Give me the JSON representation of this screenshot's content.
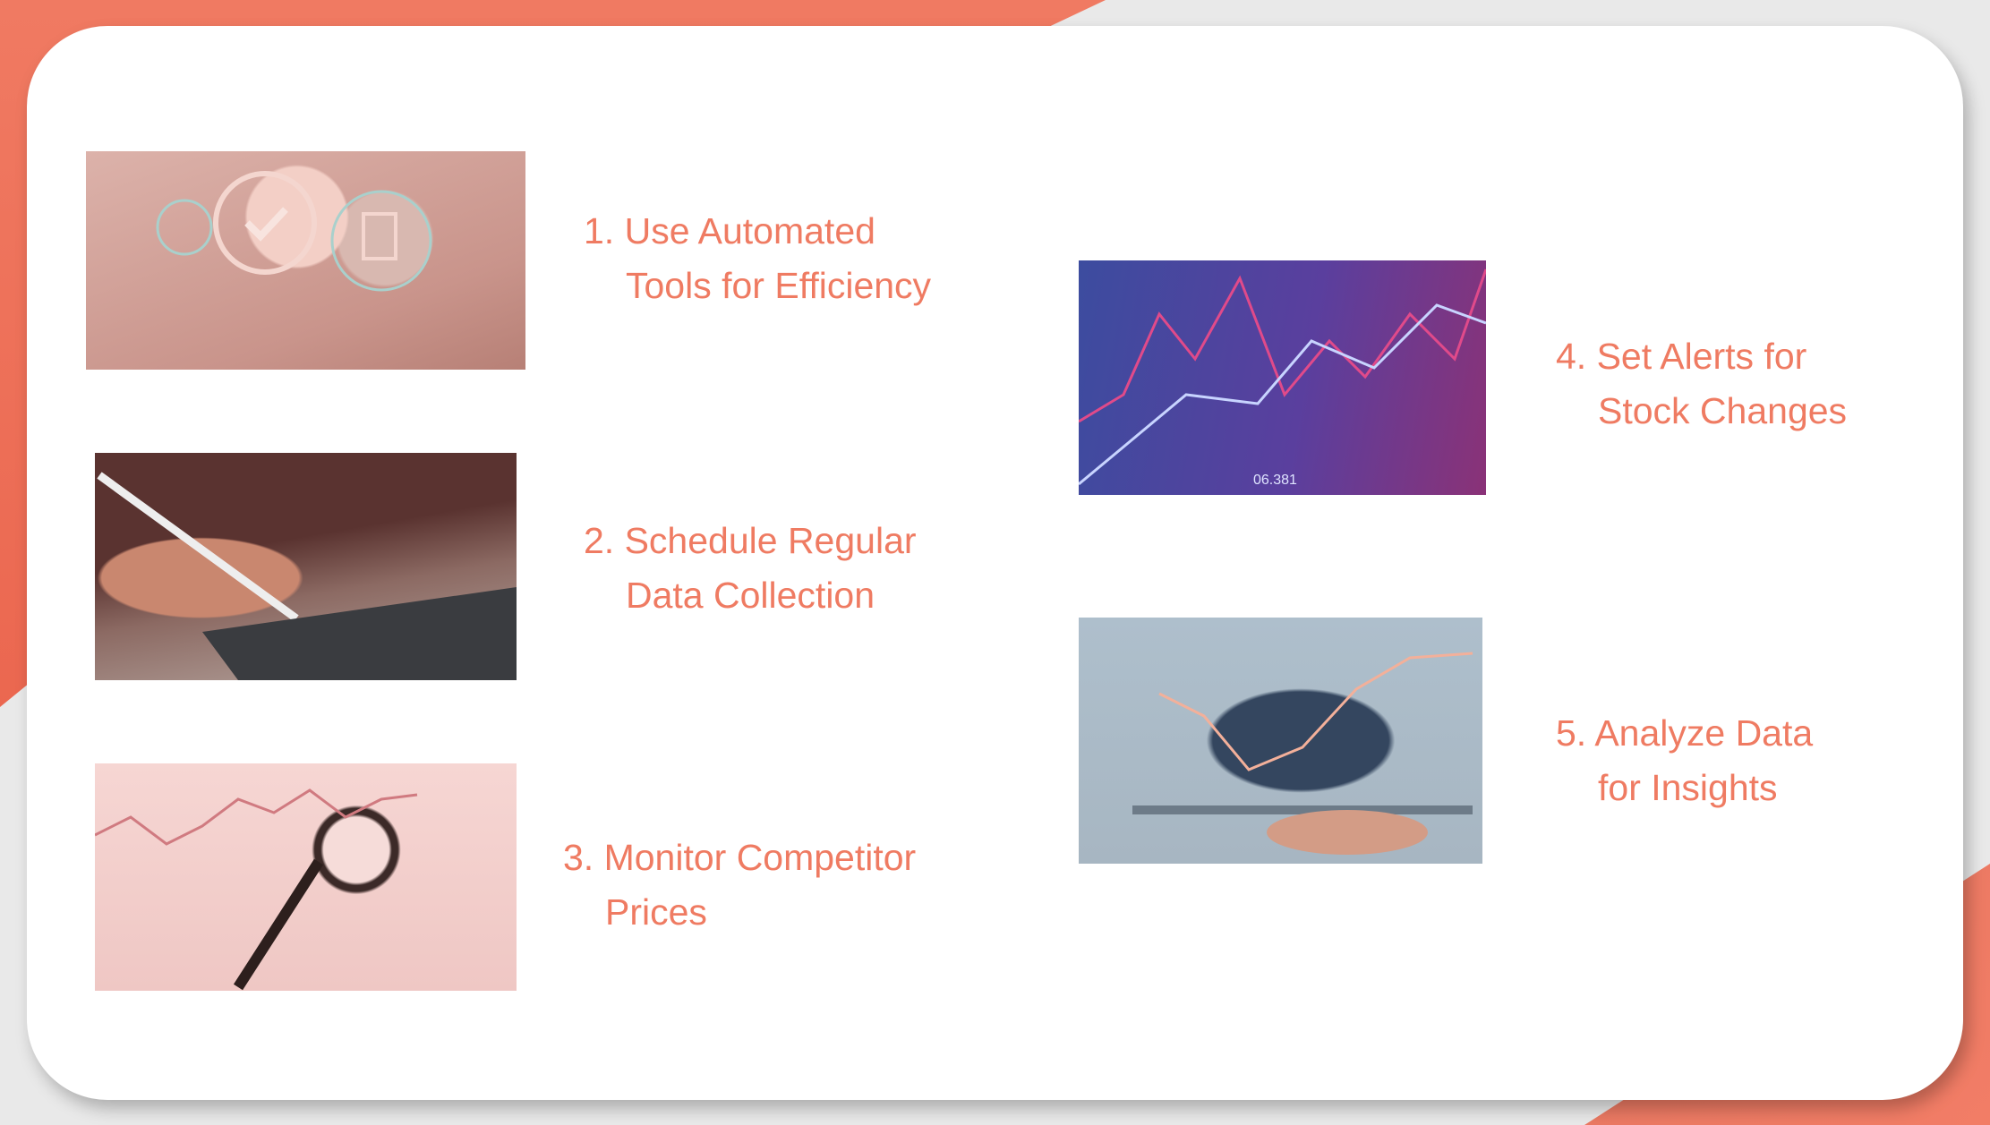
{
  "colors": {
    "accent": "#ef7b62",
    "background_coral": "#ee6b53",
    "card": "#ffffff"
  },
  "items": [
    {
      "line1": "1. Use Automated",
      "line2": "Tools for Efficiency",
      "image": "automation-tools-photo"
    },
    {
      "line1": "2. Schedule Regular",
      "line2": "Data Collection",
      "image": "tablet-stylus-photo"
    },
    {
      "line1": "3. Monitor Competitor",
      "line2": "Prices",
      "image": "magnifier-chart-photo"
    },
    {
      "line1": "4. Set Alerts for",
      "line2": "Stock Changes",
      "image": "stock-chart-photo",
      "image_text": "06.381"
    },
    {
      "line1": "5. Analyze Data",
      "line2": "for Insights",
      "image": "tablet-analytics-photo"
    }
  ]
}
